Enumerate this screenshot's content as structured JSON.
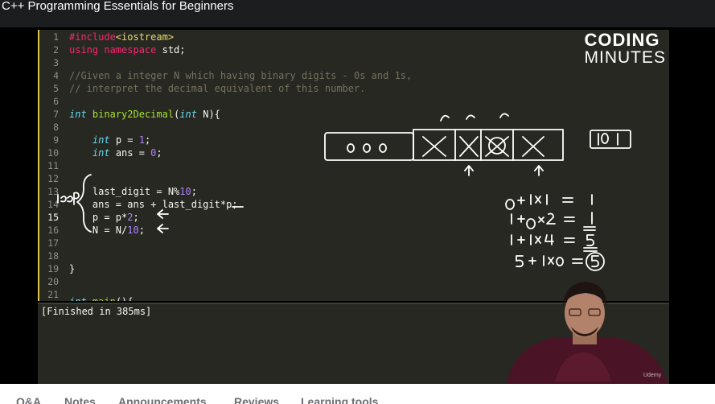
{
  "header": {
    "title": "C++ Programming Essentials for Beginners"
  },
  "logo": {
    "line1": "CODING",
    "line2": "MINUTES"
  },
  "code": {
    "line_numbers": [
      "1",
      "2",
      "3",
      "4",
      "5",
      "6",
      "7",
      "8",
      "9",
      "10",
      "11",
      "12",
      "13",
      "14",
      "15",
      "16",
      "17",
      "18",
      "19",
      "20",
      "21"
    ],
    "active_line": "15"
  },
  "console": {
    "output": "[Finished in 385ms]"
  },
  "watermark": "Udemy",
  "tabs": [
    "Q&A",
    "Notes",
    "Announcements",
    "Reviews",
    "Learning tools"
  ],
  "colors": {
    "editor_bg": "#272822",
    "keyword": "#f92672",
    "type": "#66d9ef",
    "string": "#e6db74",
    "number": "#ae81ff",
    "comment": "#75715e",
    "accent": "#d9c34a"
  }
}
